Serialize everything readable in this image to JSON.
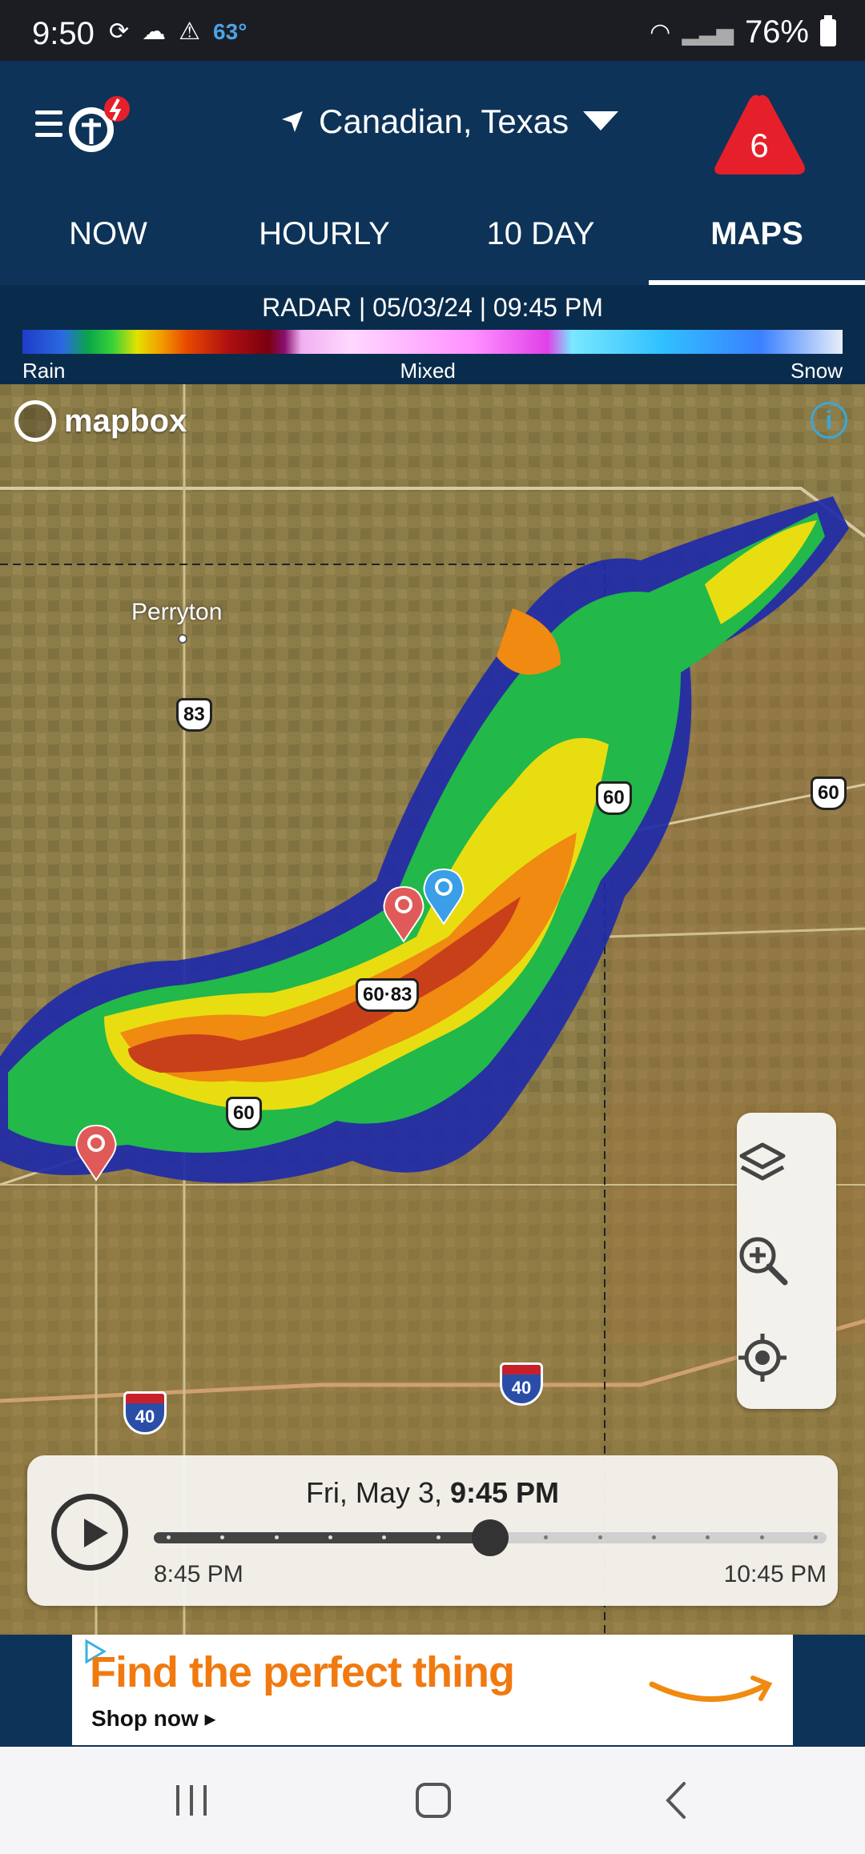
{
  "status_bar": {
    "time": "9:50",
    "temperature": "63°",
    "battery": "76%"
  },
  "header": {
    "location": "Canadian, Texas",
    "alert_count": "6"
  },
  "tabs": [
    {
      "label": "NOW",
      "active": false
    },
    {
      "label": "HOURLY",
      "active": false
    },
    {
      "label": "10 DAY",
      "active": false
    },
    {
      "label": "MAPS",
      "active": true
    }
  ],
  "legend": {
    "title": "RADAR | 05/03/24 | 09:45 PM",
    "labels": [
      "Rain",
      "Mixed",
      "Snow"
    ]
  },
  "map": {
    "attribution": "mapbox",
    "info_symbol": "i",
    "city": "Perryton",
    "highway_shields": [
      "83",
      "60",
      "60",
      "60·83",
      "60"
    ],
    "interstate_shields": [
      "40",
      "40"
    ]
  },
  "timeline": {
    "date": "Fri, May 3,",
    "time": "9:45 PM",
    "start": "8:45 PM",
    "end": "10:45 PM",
    "position_fraction": 0.5
  },
  "ad": {
    "headline": "Find the perfect thing",
    "cta": "Shop now ▸"
  },
  "colors": {
    "header_bg": "#0d3358",
    "alert_red": "#e5202a",
    "pin_red": "#e05a5a",
    "pin_blue": "#3a9ee8"
  }
}
